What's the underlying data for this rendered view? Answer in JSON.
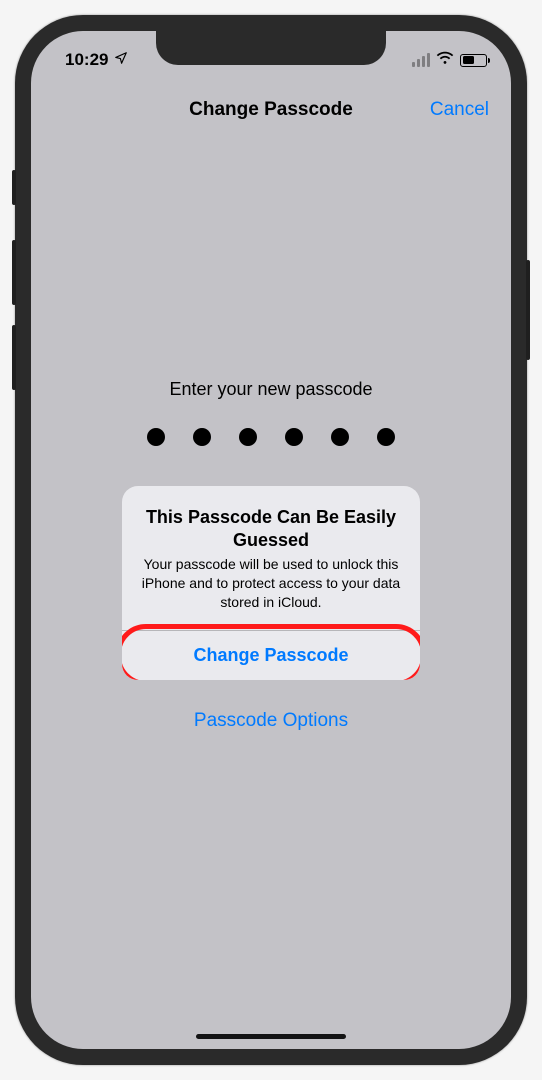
{
  "status": {
    "time": "10:29",
    "location_icon": "location-arrow-icon",
    "signal_icon": "signal-bars-icon",
    "wifi_icon": "wifi-icon",
    "battery_icon": "battery-icon"
  },
  "nav": {
    "title": "Change Passcode",
    "cancel": "Cancel"
  },
  "prompt": "Enter your new passcode",
  "passcode": {
    "dots_filled": 6
  },
  "alert": {
    "title": "This Passcode Can Be Easily Guessed",
    "message": "Your passcode will be used to unlock this iPhone and to protect access to your data stored in iCloud.",
    "button": "Change Passcode"
  },
  "options_link": "Passcode Options",
  "colors": {
    "accent": "#007aff",
    "highlight": "#ff1a1a",
    "screen_bg": "#c3c2c7"
  }
}
